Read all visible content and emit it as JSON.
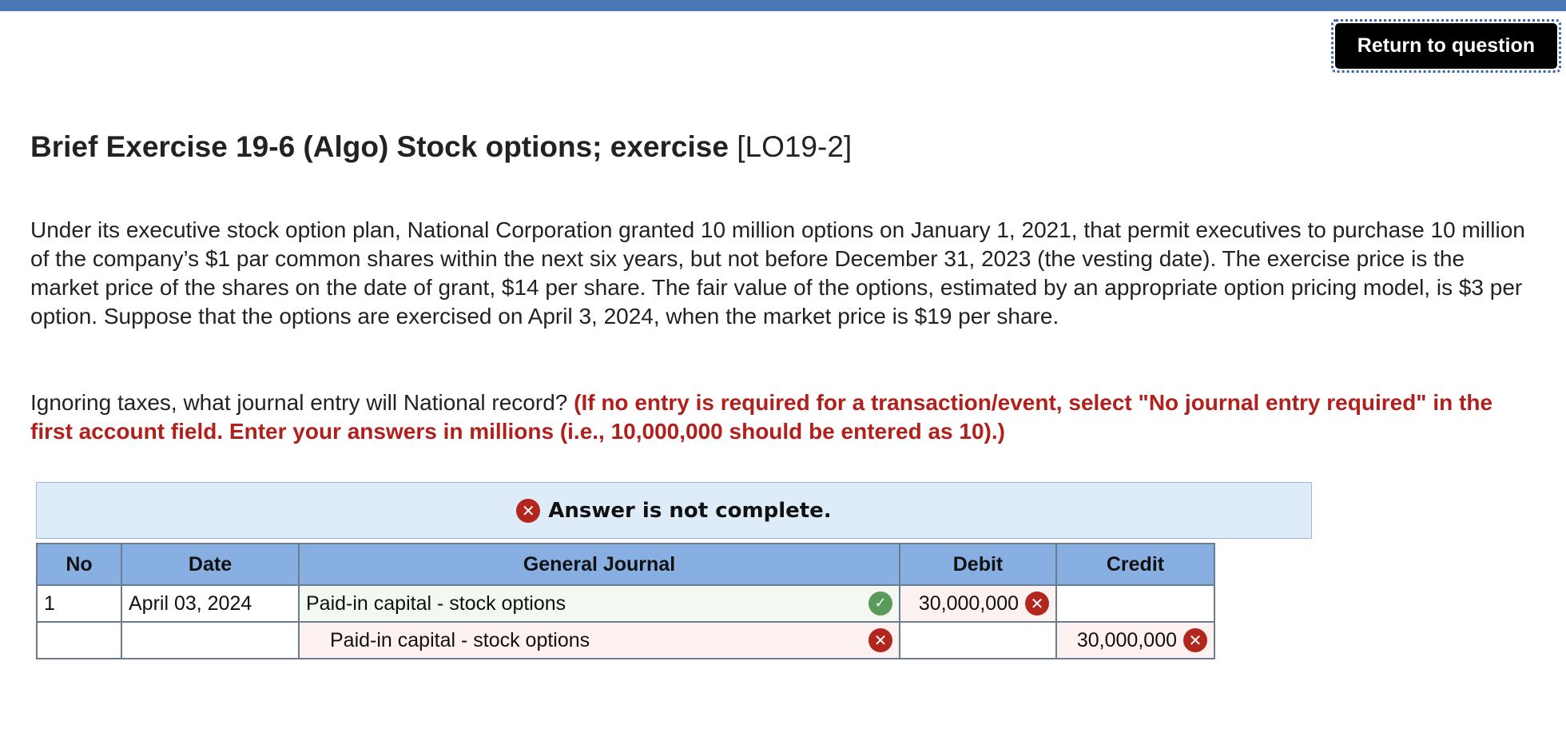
{
  "header": {
    "return_button_label": "Return to question"
  },
  "exercise": {
    "title": "Brief Exercise 19-6 (Algo) Stock options; exercise",
    "code": "[LO19-2]",
    "paragraph": "Under its executive stock option plan, National Corporation granted 10 million options on January 1, 2021, that permit executives to purchase 10 million of the company’s $1 par common shares within the next six years, but not before December 31, 2023 (the vesting date). The exercise price is the market price of the shares on the date of grant, $14 per share. The fair value of the options, estimated by an appropriate option pricing model, is $3 per option. Suppose that the options are exercised on April 3, 2024, when the market price is $19 per share.",
    "question": "Ignoring taxes, what journal entry will National record?",
    "instruction": "(If no entry is required for a transaction/event, select \"No journal entry required\" in the first account field. Enter your answers in millions (i.e., 10,000,000 should be entered as 10).)"
  },
  "answer_status": {
    "message": "Answer is not complete.",
    "icon": "x-circle-icon",
    "color": "#b3261e"
  },
  "journal": {
    "columns": [
      "No",
      "Date",
      "General Journal",
      "Debit",
      "Credit"
    ],
    "rows": [
      {
        "no": "1",
        "date": "April 03, 2024",
        "account": "Paid-in capital - stock options",
        "account_status": "correct",
        "debit": "30,000,000",
        "debit_status": "incorrect",
        "credit": "",
        "credit_status": ""
      },
      {
        "no": "",
        "date": "",
        "account": "Paid-in capital - stock options",
        "account_status": "incorrect",
        "debit": "",
        "debit_status": "",
        "credit": "30,000,000",
        "credit_status": "incorrect"
      }
    ]
  },
  "colors": {
    "top_bar": "#4a77b4",
    "header_row": "#87afe2",
    "banner_bg": "#deebf8",
    "instruction_red": "#b0201c",
    "correct_green": "#5a9a5a",
    "incorrect_red": "#b3261e"
  }
}
